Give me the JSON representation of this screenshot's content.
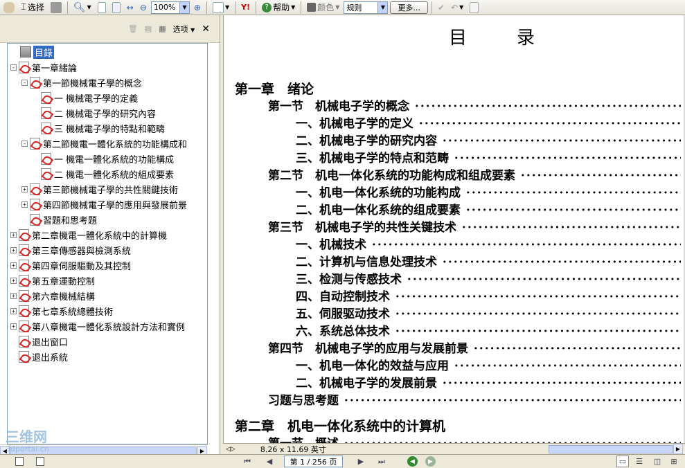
{
  "toolbar": {
    "select_label": "选择",
    "zoom_value": "100%",
    "help_label": "帮助",
    "color_label": "颜色",
    "view_value": "规则",
    "more_label": "更多..."
  },
  "bookmarks": {
    "options_label": "选项",
    "items": [
      {
        "label": "目錄",
        "level": 0,
        "expander": "",
        "selected": true
      },
      {
        "label": "第一章緒論",
        "level": 0,
        "expander": "-"
      },
      {
        "label": "第一節機械電子學的概念",
        "level": 1,
        "expander": "-"
      },
      {
        "label": "一 機械電子學的定義",
        "level": 2,
        "expander": ""
      },
      {
        "label": "二 機械電子學的研究內容",
        "level": 2,
        "expander": ""
      },
      {
        "label": "三 機械電子學的特點和範疇",
        "level": 2,
        "expander": ""
      },
      {
        "label": "第二節機電一體化系統的功能構成和",
        "level": 1,
        "expander": "-"
      },
      {
        "label": "一 機電一體化系統的功能構成",
        "level": 2,
        "expander": ""
      },
      {
        "label": "二 機電一體化系統的組成要素",
        "level": 2,
        "expander": ""
      },
      {
        "label": "第三節機械電子學的共性關鍵技術",
        "level": 1,
        "expander": "+"
      },
      {
        "label": "第四節機械電子學的應用與發展前景",
        "level": 1,
        "expander": "+"
      },
      {
        "label": "習題和思考題",
        "level": 1,
        "expander": ""
      },
      {
        "label": "第二章機電一體化系統中的計算機",
        "level": 0,
        "expander": "+"
      },
      {
        "label": "第三章傳感器與檢測系統",
        "level": 0,
        "expander": "+"
      },
      {
        "label": "第四章伺服驅動及其控制",
        "level": 0,
        "expander": "+"
      },
      {
        "label": "第五章運動控制",
        "level": 0,
        "expander": "+"
      },
      {
        "label": "第六章機械結構",
        "level": 0,
        "expander": "+"
      },
      {
        "label": "第七章系統總體技術",
        "level": 0,
        "expander": "+"
      },
      {
        "label": "第八章機電一體化系統設計方法和實例",
        "level": 0,
        "expander": "+"
      },
      {
        "label": "退出窗口",
        "level": 0,
        "expander": ""
      },
      {
        "label": "退出系統",
        "level": 0,
        "expander": ""
      }
    ]
  },
  "document": {
    "title": "目录",
    "entries": [
      {
        "text": "第一章　绪论",
        "kind": "chapter",
        "dots": false
      },
      {
        "text": "第一节　机械电子学的概念",
        "kind": "section",
        "dots": true
      },
      {
        "text": "一、机械电子学的定义",
        "kind": "item",
        "dots": true
      },
      {
        "text": "二、机械电子学的研究内容",
        "kind": "item",
        "dots": true
      },
      {
        "text": "三、机械电子学的特点和范畴",
        "kind": "item",
        "dots": true
      },
      {
        "text": "第二节　机电一体化系统的功能构成和组成要素",
        "kind": "section",
        "dots": true
      },
      {
        "text": "一、机电一体化系统的功能构成",
        "kind": "item",
        "dots": true
      },
      {
        "text": "二、机电一体化系统的组成要素",
        "kind": "item",
        "dots": true
      },
      {
        "text": "第三节　机械电子学的共性关键技术",
        "kind": "section",
        "dots": true
      },
      {
        "text": "一、机械技术",
        "kind": "item",
        "dots": true
      },
      {
        "text": "二、计算机与信息处理技术",
        "kind": "item",
        "dots": true
      },
      {
        "text": "三、检测与传感技术",
        "kind": "item",
        "dots": true
      },
      {
        "text": "四、自动控制技术",
        "kind": "item",
        "dots": true
      },
      {
        "text": "五、伺服驱动技术",
        "kind": "item",
        "dots": true
      },
      {
        "text": "六、系统总体技术",
        "kind": "item",
        "dots": true
      },
      {
        "text": "第四节　机械电子学的应用与发展前景",
        "kind": "section",
        "dots": true
      },
      {
        "text": "一、机电一体化的效益与应用",
        "kind": "item",
        "dots": true
      },
      {
        "text": "二、机械电子学的发展前景",
        "kind": "item",
        "dots": true
      },
      {
        "text": "习题与思考题",
        "kind": "section",
        "dots": true
      },
      {
        "text": "第二章　机电一体化系统中的计算机",
        "kind": "chapter",
        "dots": false
      },
      {
        "text": "第一节　概述",
        "kind": "section",
        "dots": true
      }
    ]
  },
  "status": {
    "page_size": "8.26 x 11.69 英寸",
    "page_indicator": "第 1 / 256 页"
  },
  "watermark": {
    "line1": "三维网",
    "line2": "3dportal.cn"
  },
  "colors": {
    "selection": "#316ac5",
    "toolbar_bg": "#ece9d8"
  }
}
